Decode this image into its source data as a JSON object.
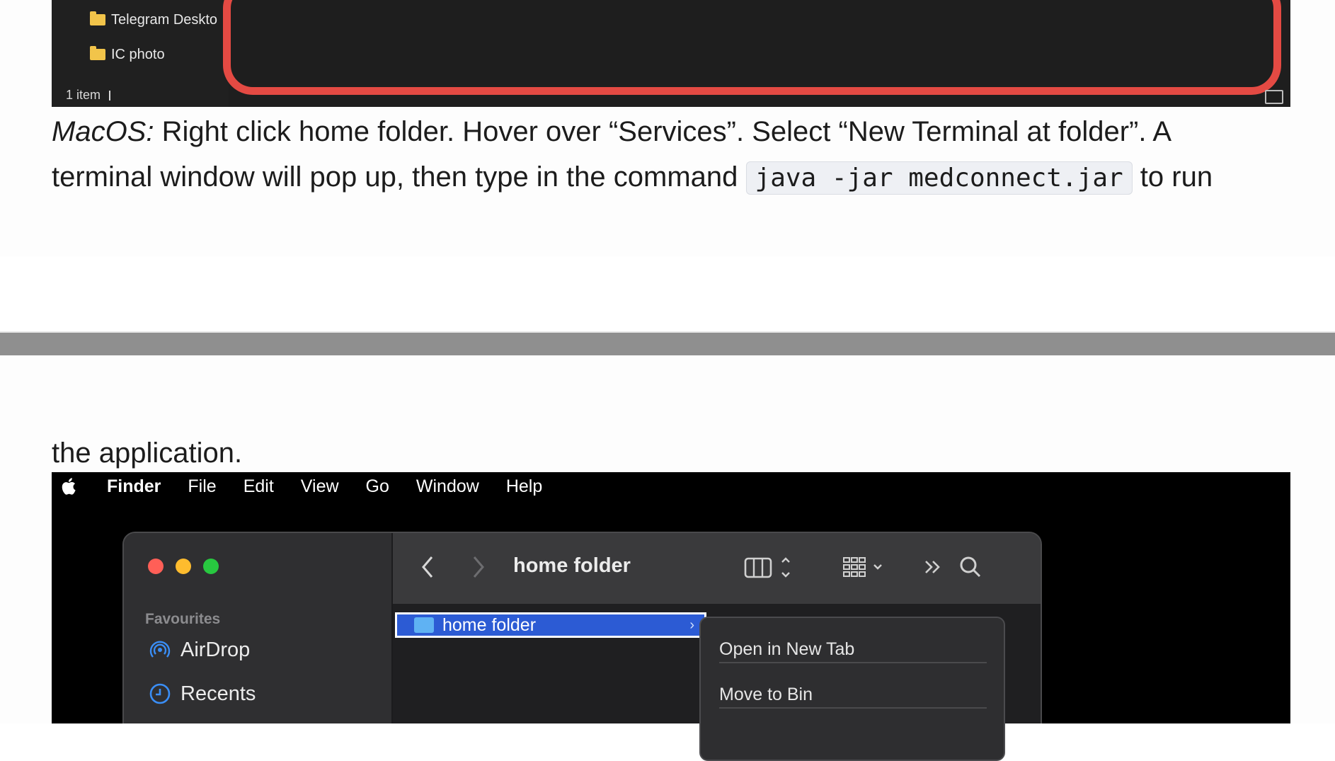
{
  "top_screenshot": {
    "nav_items": [
      "Telegram Deskto",
      "IC photo"
    ],
    "status": "1 item"
  },
  "instructions": {
    "os_label": "MacOS:",
    "line1": " Right click home folder. Hover over “Services”. Select “New Terminal at folder”. A",
    "line2_before": "terminal window will pop up, then type in the command ",
    "command": "java -jar medconnect.jar",
    "line2_after": " to run",
    "line3": "the application."
  },
  "mac": {
    "menubar": [
      "Finder",
      "File",
      "Edit",
      "View",
      "Go",
      "Window",
      "Help"
    ],
    "finder": {
      "window_title": "home folder",
      "sidebar_section": "Favourites",
      "sidebar_items": [
        "AirDrop",
        "Recents"
      ],
      "selected_row": "home folder"
    },
    "context_menu": [
      "Open in New Tab",
      "Move to Bin"
    ]
  },
  "colors": {
    "highlight_red": "#e44a43",
    "selection_blue": "#2c5bd4",
    "traffic_red": "#ff5f57",
    "traffic_yellow": "#febc2e",
    "traffic_green": "#28c840"
  }
}
